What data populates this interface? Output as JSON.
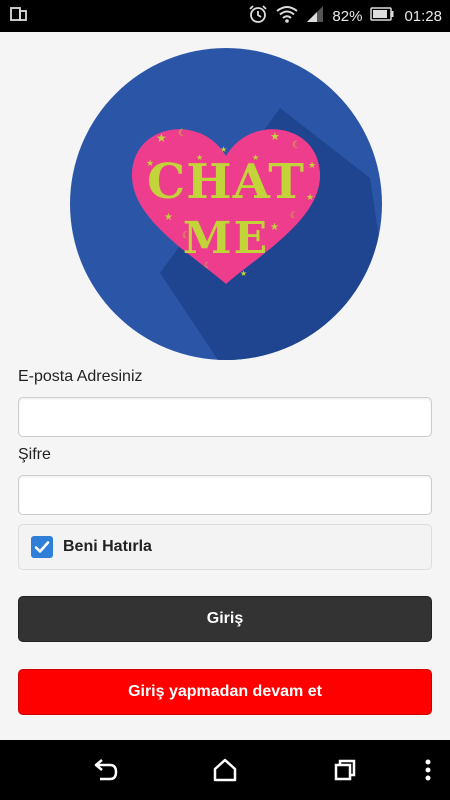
{
  "status_bar": {
    "battery": "82%",
    "time": "01:28"
  },
  "logo": {
    "line1": "CHAT",
    "line2": "ME",
    "circle_color": "#2b56a8",
    "heart_color": "#ee3d8d",
    "text_color": "#c3d33a"
  },
  "form": {
    "email_label": "E-posta Adresiniz",
    "email_value": "",
    "password_label": "Şifre",
    "password_value": "",
    "remember_label": "Beni Hatırla",
    "remember_checked": true
  },
  "buttons": {
    "login": "Giriş",
    "guest": "Giriş yapmadan devam et"
  }
}
